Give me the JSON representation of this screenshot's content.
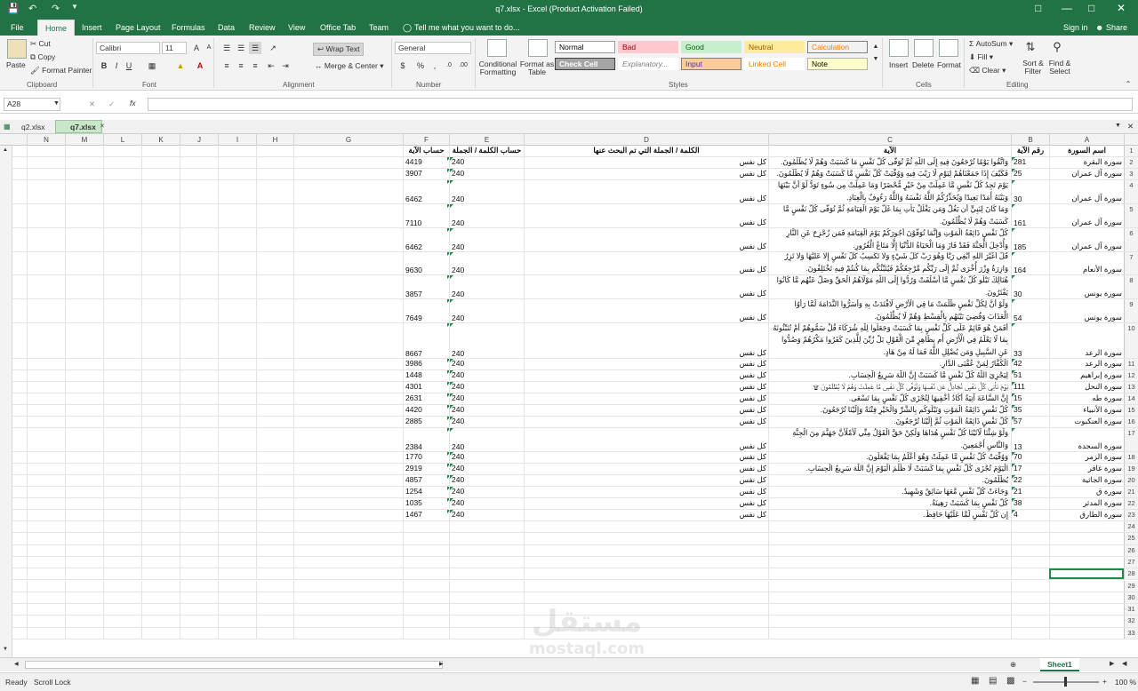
{
  "window": {
    "title": "q7.xlsx - Excel (Product Activation Failed)",
    "signin": "Sign in",
    "share": "Share"
  },
  "ribbon_tabs": [
    "File",
    "Home",
    "Insert",
    "Page Layout",
    "Formulas",
    "Data",
    "Review",
    "View",
    "Office Tab",
    "Team"
  ],
  "tell_me": "Tell me what you want to do...",
  "clipboard": {
    "paste": "Paste",
    "cut": "Cut",
    "copy": "Copy",
    "format_painter": "Format Painter",
    "label": "Clipboard"
  },
  "font": {
    "name": "Calibri",
    "size": "11",
    "label": "Font",
    "bold": "B",
    "italic": "I",
    "underline": "U"
  },
  "alignment": {
    "wrap_text": "Wrap Text",
    "merge_center": "Merge & Center",
    "label": "Alignment"
  },
  "number": {
    "format": "General",
    "percent": "%",
    "comma": ",",
    "label": "Number"
  },
  "styles": {
    "conditional": "Conditional Formatting",
    "format_table": "Format as Table",
    "label": "Styles",
    "cells": [
      {
        "name": "Normal",
        "bg": "#ffffff",
        "fg": "#000000",
        "border": "#9c9c9c"
      },
      {
        "name": "Bad",
        "bg": "#ffc7ce",
        "fg": "#9c0006",
        "border": "#ffc7ce"
      },
      {
        "name": "Good",
        "bg": "#c6efce",
        "fg": "#006100",
        "border": "#c6efce"
      },
      {
        "name": "Neutral",
        "bg": "#ffeb9c",
        "fg": "#9c5700",
        "border": "#ffeb9c"
      },
      {
        "name": "Calculation",
        "bg": "#f2f2f2",
        "fg": "#fa7d00",
        "border": "#7f7f7f"
      },
      {
        "name": "Check Cell",
        "bg": "#a5a5a5",
        "fg": "#ffffff",
        "border": "#3f3f3f"
      },
      {
        "name": "Explanatory...",
        "bg": "#ffffff",
        "fg": "#7f7f7f",
        "border": "#ffffff"
      },
      {
        "name": "Input",
        "bg": "#ffcc99",
        "fg": "#3f3f76",
        "border": "#7f7f7f"
      },
      {
        "name": "Linked Cell",
        "bg": "#ffffff",
        "fg": "#fa7d00",
        "border": "#ffffff"
      },
      {
        "name": "Note",
        "bg": "#ffffcc",
        "fg": "#000000",
        "border": "#b2b2b2"
      }
    ]
  },
  "cells_group": {
    "insert": "Insert",
    "delete": "Delete",
    "format": "Format",
    "label": "Cells"
  },
  "editing": {
    "autosum": "AutoSum",
    "fill": "Fill",
    "clear": "Clear",
    "sort_filter": "Sort & Filter",
    "find_select": "Find & Select",
    "label": "Editing"
  },
  "formula_bar": {
    "name_box": "A28",
    "fx": "fx",
    "content": ""
  },
  "workbook_tabs": [
    "q2.xlsx",
    "q7.xlsx"
  ],
  "columns": [
    "N",
    "M",
    "L",
    "K",
    "J",
    "I",
    "H",
    "G",
    "F",
    "E",
    "D",
    "C",
    "B",
    "A"
  ],
  "header_row": {
    "A": "اسم السورة",
    "B": "رقم الآية",
    "C": "الآية",
    "D": "الكلمة / الجملة التي تم البحث عنها",
    "E": "حساب الكلمة / الجملة",
    "F": "حساب الآية"
  },
  "rows": [
    {
      "n": "2",
      "A": "سورة البقرة",
      "B": "281",
      "C": "وَاتَّقُوا يَوْمًا تُرْجَعُونَ فِيهِ إِلَى اللَّهِ ثُمَّ تُوَفَّى كُلُّ نَفْسٍ مَا كَسَبَتْ وَهُمْ لَا يُظْلَمُونَ.",
      "D": "كل نفس",
      "E": "240",
      "F": "4419"
    },
    {
      "n": "3",
      "A": "سورة آل عمران",
      "B": "25",
      "C": "فَكَيْفَ إِذَا جَمَعْنَاهُمْ لِيَوْمٍ لَّا رَيْبَ فِيهِ وَوُفِّيَتْ كُلُّ نَفْسٍ مَّا كَسَبَتْ وَهُمْ لَا يُظْلَمُونَ.",
      "D": "كل نفس",
      "E": "240",
      "F": "3907"
    },
    {
      "n": "4",
      "A": "سورة آل عمران",
      "B": "30",
      "C": "يَوْمَ تَجِدُ كُلُّ نَفْسٍ مَّا عَمِلَتْ مِنْ خَيْرٍ مُّحْضَرًا وَمَا عَمِلَتْ مِن سُوءٍ تَوَدُّ لَوْ أَنَّ بَيْنَهَا وَبَيْنَهُ أَمَدًا بَعِيدًا وَيُحَذِّرُكُمُ اللَّهُ نَفْسَهُ وَاللَّهُ رَءُوفٌ بِالْعِبَادِ.",
      "D": "كل نفس",
      "E": "240",
      "F": "6462"
    },
    {
      "n": "5",
      "A": "سورة آل عمران",
      "B": "161",
      "C": "وَمَا كَانَ لِنَبِيٍّ أَن يَغُلَّ وَمَن يَغْلُلْ يَأْتِ بِمَا غَلَّ يَوْمَ الْقِيَامَةِ ثُمَّ تُوَفَّى كُلُّ نَفْسٍ مَّا كَسَبَتْ وَهُمْ لَا يُظْلَمُونَ.",
      "D": "كل نفس",
      "E": "240",
      "F": "7110"
    },
    {
      "n": "6",
      "A": "سورة آل عمران",
      "B": "185",
      "C": "كُلُّ نَفْسٍ ذَائِقَةُ الْمَوْتِ وَإِنَّمَا تُوَفَّوْنَ أُجُورَكُمْ يَوْمَ الْقِيَامَةِ فَمَن زُحْزِحَ عَنِ النَّارِ وَأُدْخِلَ الْجَنَّةَ فَقَدْ فَازَ وَمَا الْحَيَاةُ الدُّنْيَا إِلَّا مَتَاعُ الْغُرُورِ.",
      "D": "كل نفس",
      "E": "240",
      "F": "6462"
    },
    {
      "n": "7",
      "A": "سورة الأنعام",
      "B": "164",
      "C": "قُلْ أَغَيْرَ اللَّهِ أَبْغِي رَبًّا وَهُوَ رَبُّ كُلِّ شَيْءٍ وَلَا تَكْسِبُ كُلُّ نَفْسٍ إِلَّا عَلَيْهَا وَلَا تَزِرُ وَازِرَةٌ وِزْرَ أُخْرَى ثُمَّ إِلَى رَبِّكُم مَّرْجِعُكُمْ فَيُنَبِّئُكُم بِمَا كُنتُمْ فِيهِ تَخْتَلِفُونَ.",
      "D": "كل نفس",
      "E": "240",
      "F": "9630"
    },
    {
      "n": "8",
      "A": "سورة يونس",
      "B": "30",
      "C": "هُنَالِكَ تَبْلُو كُلُّ نَفْسٍ مَّا أَسْلَفَتْ وَرُدُّوا إِلَى اللَّهِ مَوْلَاهُمُ الْحَقِّ وَضَلَّ عَنْهُم مَّا كَانُوا يَفْتَرُونَ.",
      "D": "كل نفس",
      "E": "240",
      "F": "3857"
    },
    {
      "n": "9",
      "A": "سورة يونس",
      "B": "54",
      "C": "وَلَوْ أَنَّ لِكُلِّ نَفْسٍ ظَلَمَتْ مَا فِي الْأَرْضِ لَافْتَدَتْ بِهِ وَأَسَرُّوا النَّدَامَةَ لَمَّا رَأَوُا الْعَذَابَ وَقُضِيَ بَيْنَهُم بِالْقِسْطِ وَهُمْ لَا يُظْلَمُونَ.",
      "D": "كل نفس",
      "E": "240",
      "F": "7649"
    },
    {
      "n": "10",
      "A": "سورة الرعد",
      "B": "33",
      "C": "أَفَمَنْ هُوَ قَائِمٌ عَلَى كُلِّ نَفْسٍ بِمَا كَسَبَتْ وَجَعَلُوا لِلَّهِ شُرَكَاءَ قُلْ سَمُّوهُمْ أَمْ تُنَبِّئُونَهُ بِمَا لَا يَعْلَمُ فِي الْأَرْضِ أَم بِظَاهِرٍ مِّنَ الْقَوْلِ بَلْ زُيِّنَ لِلَّذِينَ كَفَرُوا مَكْرُهُمْ وَصُدُّوا عَنِ السَّبِيلِ وَمَن يُضْلِلِ اللَّهُ فَمَا لَهُ مِنْ هَادٍ.",
      "D": "كل نفس",
      "E": "240",
      "F": "8667"
    },
    {
      "n": "11",
      "A": "سورة الرعد",
      "B": "42",
      "C": "وَقَدْ مَكَرَ الَّذِينَ مِن قَبْلِهِمْ فَلِلَّهِ الْمَكْرُ جَمِيعًا يَعْلَمُ مَا تَكْسِبُ كُلُّ نَفْسٍ وَسَيَعْلَمُ الْكُفَّارُ لِمَنْ عُقْبَى الدَّارِ.",
      "D": "كل نفس",
      "E": "240",
      "F": "3986"
    },
    {
      "n": "12",
      "A": "سورة إبراهيم",
      "B": "51",
      "C": "لِيَجْزِيَ اللَّهُ كُلَّ نَفْسٍ مَّا كَسَبَتْ إِنَّ اللَّهَ سَرِيعُ الْحِسَابِ.",
      "D": "كل نفس",
      "E": "240",
      "F": "1448"
    },
    {
      "n": "13",
      "A": "سورة النحل",
      "B": "111",
      "C": "يَوْمَ تَأْتِي كُلُّ نَفْسٍ تُجَادِلُ عَن نَّفْسِهَا وَتُوَفَّى كُلُّ نَفْسٍ مَّا عَمِلَتْ وَهُمْ لَا يُظْلَمُونَ ۩",
      "D": "كل نفس",
      "E": "240",
      "F": "4301"
    },
    {
      "n": "14",
      "A": "سورة طه",
      "B": "15",
      "C": "إِنَّ السَّاعَةَ آتِيَةٌ أَكَادُ أُخْفِيهَا لِتُجْزَى كُلُّ نَفْسٍ بِمَا تَسْعَى.",
      "D": "كل نفس",
      "E": "240",
      "F": "2631"
    },
    {
      "n": "15",
      "A": "سورة الأنبياء",
      "B": "35",
      "C": "كُلُّ نَفْسٍ ذَائِقَةُ الْمَوْتِ وَنَبْلُوكُم بِالشَّرِّ وَالْخَيْرِ فِتْنَةً وَإِلَيْنَا تُرْجَعُونَ.",
      "D": "كل نفس",
      "E": "240",
      "F": "4420"
    },
    {
      "n": "16",
      "A": "سورة العنكبوت",
      "B": "57",
      "C": "كُلُّ نَفْسٍ ذَائِقَةُ الْمَوْتِ ثُمَّ إِلَيْنَا تُرْجَعُونَ.",
      "D": "كل نفس",
      "E": "240",
      "F": "2885"
    },
    {
      "n": "17",
      "A": "سورة السجدة",
      "B": "13",
      "C": "وَلَوْ شِئْنَا لَآتَيْنَا كُلَّ نَفْسٍ هُدَاهَا وَلَكِنْ حَقَّ الْقَوْلُ مِنِّي لَأَمْلَأَنَّ جَهَنَّمَ مِنَ الْجِنَّةِ وَالنَّاسِ أَجْمَعِينَ.",
      "D": "كل نفس",
      "E": "240",
      "F": "2384"
    },
    {
      "n": "18",
      "A": "سورة الزمر",
      "B": "70",
      "C": "وَوُفِّيَتْ كُلُّ نَفْسٍ مَّا عَمِلَتْ وَهُوَ أَعْلَمُ بِمَا يَفْعَلُونَ.",
      "D": "كل نفس",
      "E": "240",
      "F": "1770"
    },
    {
      "n": "19",
      "A": "سورة غافر",
      "B": "17",
      "C": "الْيَوْمَ تُجْزَى كُلُّ نَفْسٍ بِمَا كَسَبَتْ لَا ظُلْمَ الْيَوْمَ إِنَّ اللَّهَ سَرِيعُ الْحِسَابِ.",
      "D": "كل نفس",
      "E": "240",
      "F": "2919"
    },
    {
      "n": "20",
      "A": "سورة الجاثية",
      "B": "22",
      "C": "وَخَلَقَ اللَّهُ السَّمَاوَاتِ وَالْأَرْضَ بِالْحَقِّ وَلِتُجْزَى كُلُّ نَفْسٍ بِمَا كَسَبَتْ وَهُمْ لَا يُظْلَمُونَ.",
      "D": "كل نفس",
      "E": "240",
      "F": "4857"
    },
    {
      "n": "21",
      "A": "سورة ق",
      "B": "21",
      "C": "وَجَاءَتْ كُلُّ نَفْسٍ مَّعَهَا سَائِقٌ وَشَهِيدٌ.",
      "D": "كل نفس",
      "E": "240",
      "F": "1254"
    },
    {
      "n": "22",
      "A": "سورة المدثر",
      "B": "38",
      "C": "كُلُّ نَفْسٍ بِمَا كَسَبَتْ رَهِينَةٌ.",
      "D": "كل نفس",
      "E": "240",
      "F": "1035"
    },
    {
      "n": "23",
      "A": "سورة الطارق",
      "B": "4",
      "C": "إِن كُلُّ نَفْسٍ لَّمَّا عَلَيْهَا حَافِظٌ.",
      "D": "كل نفس",
      "E": "240",
      "F": "1467"
    }
  ],
  "empty_rows": [
    "24",
    "25",
    "26",
    "27",
    "28",
    "29",
    "30",
    "31",
    "32",
    "33"
  ],
  "sheet_tab": "Sheet1",
  "status": {
    "ready": "Ready",
    "scroll_lock": "Scroll Lock",
    "zoom": "100 %"
  },
  "watermark": {
    "ar": "مستقل",
    "en": "mostaql.com"
  },
  "colors": {
    "excel_green": "#217346",
    "selection": "#1e8b4a"
  }
}
